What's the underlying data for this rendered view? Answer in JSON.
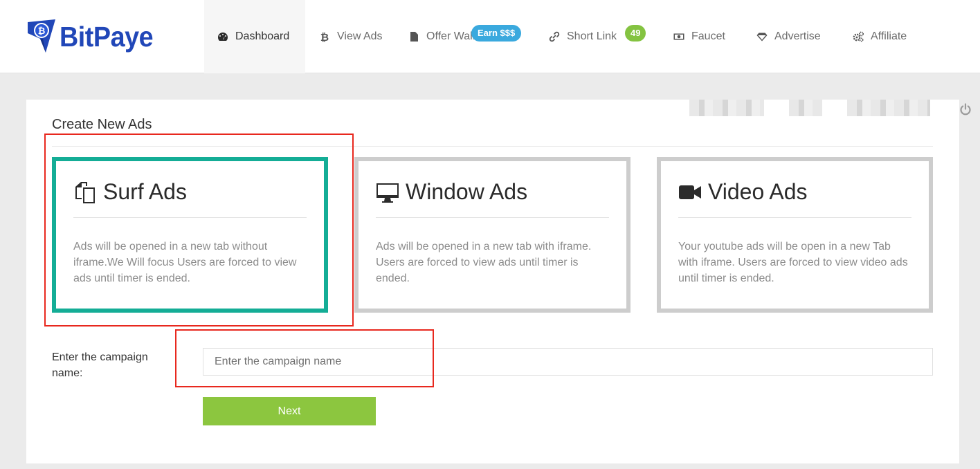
{
  "brand": {
    "name": "BitPaye",
    "color": "#2147b8"
  },
  "nav": {
    "items": [
      {
        "label": "Dashboard",
        "icon": "dashboard-icon",
        "active": true
      },
      {
        "label": "View Ads",
        "icon": "bitcoin-icon"
      },
      {
        "label": "Offer Wall",
        "icon": "document-icon",
        "badge": "Earn $$$"
      },
      {
        "label": "Short Link",
        "icon": "link-icon",
        "badge": "49"
      },
      {
        "label": "Faucet",
        "icon": "money-icon"
      },
      {
        "label": "Advertise",
        "icon": "diamond-icon"
      },
      {
        "label": "Affiliate",
        "icon": "gears-icon"
      }
    ]
  },
  "panel": {
    "title": "Create New Ads",
    "cards": [
      {
        "title": "Surf Ads",
        "icon": "copy-pages-icon",
        "description": "Ads will be opened in a new tab without iframe.We Will focus Users are forced to view ads until timer is ended.",
        "selected": true
      },
      {
        "title": "Window Ads",
        "icon": "monitor-icon",
        "description": "Ads will be opened in a new tab with iframe. Users are forced to view ads until timer is ended."
      },
      {
        "title": "Video Ads",
        "icon": "video-camera-icon",
        "description": "Your youtube ads will be open in a new Tab with iframe. Users are forced to view video ads until timer is ended."
      }
    ],
    "campaign": {
      "label": "Enter the campaign name:",
      "placeholder": "Enter the campaign name",
      "value": ""
    },
    "next_label": "Next"
  },
  "colors": {
    "selected_border": "#14ad96",
    "card_border": "#cdcdcd",
    "next_button": "#8cc63f",
    "badge_blue": "#3aa9de",
    "badge_green": "#84c341",
    "annotation": "#e8281e"
  }
}
